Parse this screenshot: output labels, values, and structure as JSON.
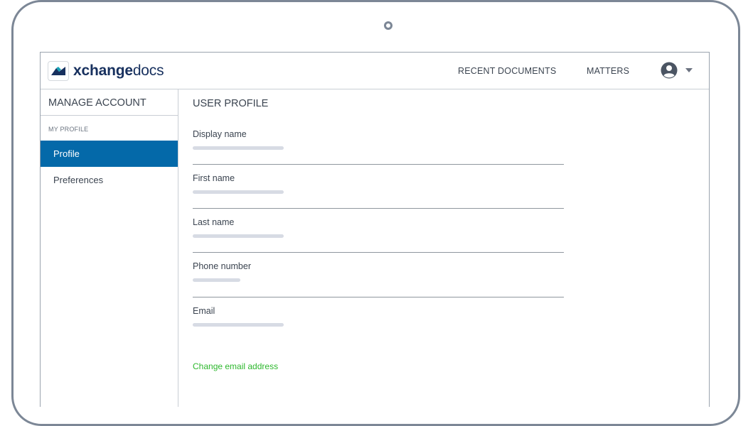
{
  "brand": {
    "bold": "xchange",
    "light": "docs"
  },
  "nav": {
    "recent": "RECENT DOCUMENTS",
    "matters": "MATTERS"
  },
  "sidebar": {
    "heading": "MANAGE ACCOUNT",
    "section": "MY PROFILE",
    "items": [
      {
        "label": "Profile",
        "active": true
      },
      {
        "label": "Preferences",
        "active": false
      }
    ]
  },
  "main": {
    "title": "USER PROFILE",
    "fields": [
      {
        "label": "Display name"
      },
      {
        "label": "First name"
      },
      {
        "label": "Last name"
      },
      {
        "label": "Phone number"
      },
      {
        "label": "Email"
      }
    ],
    "change_email": "Change email address"
  },
  "colors": {
    "accent": "#0469a9",
    "brand": "#17305e",
    "link": "#2eb82e"
  },
  "icons": {
    "user": "user-circle-icon",
    "caret": "caret-down-icon",
    "logo": "logo-icon"
  }
}
